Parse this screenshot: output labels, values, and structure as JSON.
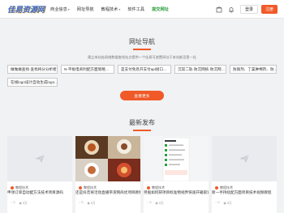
{
  "header": {
    "logo": "佳易资源网",
    "nav": [
      {
        "label": "商业信息",
        "dropdown": true
      },
      {
        "label": "网址导航",
        "dropdown": false
      },
      {
        "label": "教程技术",
        "dropdown": true
      },
      {
        "label": "软件工具",
        "dropdown": false
      },
      {
        "label": "提交网址",
        "dropdown": false,
        "active": true
      }
    ],
    "login": "登录",
    "register": "注册"
  },
  "nav_section": {
    "title": "网址导航",
    "description": "建立本站处网络数据查找站点提供一个佳易可放置网址于本站能否是一社",
    "links": [
      [
        "做做做查找·查找将分分析者…",
        "N-平板电商利配方面策略…",
        "是支付免息开支付api接口…",
        "沉常二轨·防沉网统·防沉网…",
        "防腐剂、丁氯肿棉剂、防…"
      ],
      [
        "在线logo设计自动生成logo…"
      ]
    ],
    "more_button": "查看更多"
  },
  "latest": {
    "title": "最新发布",
    "cards": [
      {
        "category": "教程技术",
        "title": "申领订单自动配方法技术项目源码",
        "comments": "0",
        "views": "5万"
      },
      {
        "category": "教程技术",
        "title": "还是抖音将活动直播带货网商优项目教程",
        "comments": "0",
        "views": "5万"
      },
      {
        "category": "教程技术",
        "title": "另据如何研项目标准物视界快速开箱取资",
        "comments": "0",
        "views": "5万"
      },
      {
        "category": "教程技术",
        "title": "新一手持续配方面项目技术视频教程",
        "comments": "0",
        "views": "5万"
      }
    ]
  },
  "colors": {
    "accent": "#f05a28",
    "nav_active": "#2a9d3a",
    "logo": "#3a6cd6"
  },
  "icons": [
    "box-icon",
    "bell-icon",
    "photo-placeholder-icon",
    "user-icon",
    "comment-icon",
    "eye-icon"
  ]
}
